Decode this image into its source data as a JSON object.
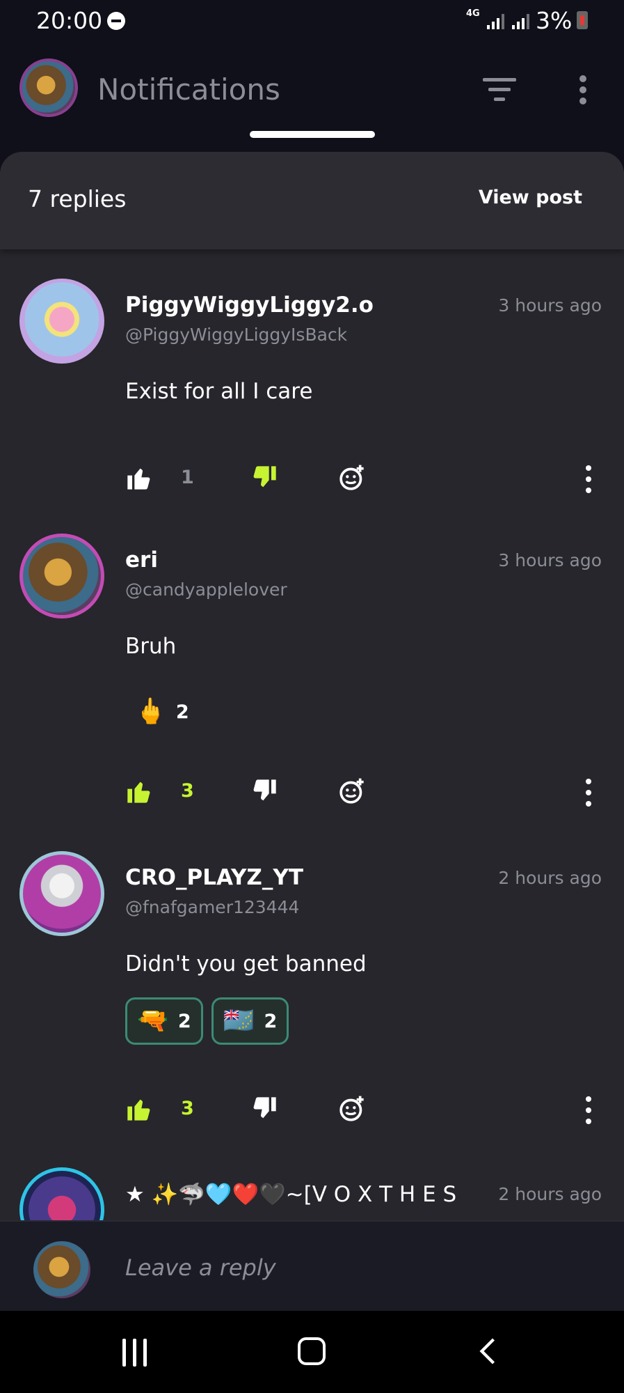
{
  "status_bar": {
    "time": "20:00",
    "network": "4G",
    "battery": "3%"
  },
  "header": {
    "title": "Notifications",
    "icons": [
      "filter-icon",
      "more-vertical-icon"
    ]
  },
  "sheet": {
    "replies_count": "7 replies",
    "view_post_label": "View post"
  },
  "comments": [
    {
      "name": "PiggyWiggyLiggy2.o",
      "handle": "@PiggyWiggyLiggyIsBack",
      "time": "3 hours ago",
      "text": "Exist for all I care",
      "reactions": [],
      "likes": "1",
      "liked": false,
      "disliked": true
    },
    {
      "name": "eri",
      "handle": "@candyapplelover",
      "time": "3 hours ago",
      "text": "Bruh",
      "reactions": [
        {
          "emoji": "🖕",
          "count": "2",
          "outlined": false
        }
      ],
      "likes": "3",
      "liked": true,
      "disliked": false
    },
    {
      "name": "CRO_PLAYZ_YT",
      "handle": "@fnafgamer123444",
      "time": "2 hours ago",
      "text": "Didn't you get banned",
      "reactions": [
        {
          "emoji": "🔫",
          "count": "2",
          "outlined": true
        },
        {
          "emoji": "🇹🇻",
          "count": "2",
          "outlined": true
        }
      ],
      "likes": "3",
      "liked": true,
      "disliked": false
    },
    {
      "name": "★ ✨🦈🩵❤️🖤~[V O X T H E S",
      "time": "2 hours ago"
    }
  ],
  "reply_bar": {
    "placeholder": "Leave a reply"
  },
  "colors": {
    "accent_green": "#c6f432",
    "background": "#26262c",
    "muted_text": "#8c8d96",
    "reaction_border": "#3d8a74"
  }
}
